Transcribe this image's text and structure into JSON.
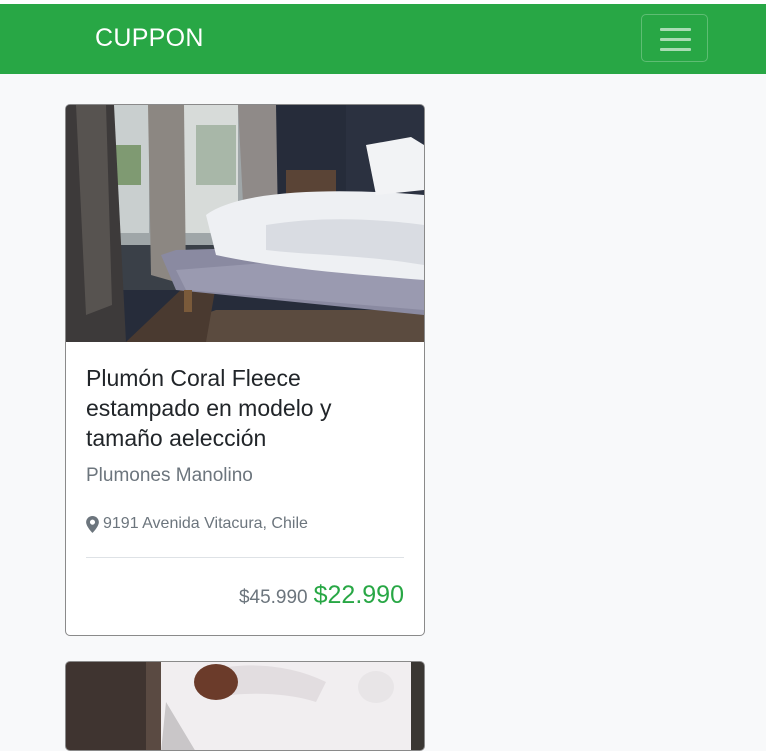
{
  "navbar": {
    "brand": "CUPPON",
    "toggle_icon": "hamburger-menu-icon",
    "bg_color": "#28a745"
  },
  "cards": [
    {
      "image_desc": "bedroom bed photo",
      "title": "Plumón Coral Fleece estampado en modelo y tamaño aelección",
      "merchant": "Plumones Manolino",
      "location_icon": "map-marker-icon",
      "address": "9191 Avenida Vitacura, Chile",
      "old_price": "$45.990",
      "new_price": "$22.990",
      "price_color": "#28a745"
    },
    {
      "image_desc": "person photo"
    }
  ]
}
